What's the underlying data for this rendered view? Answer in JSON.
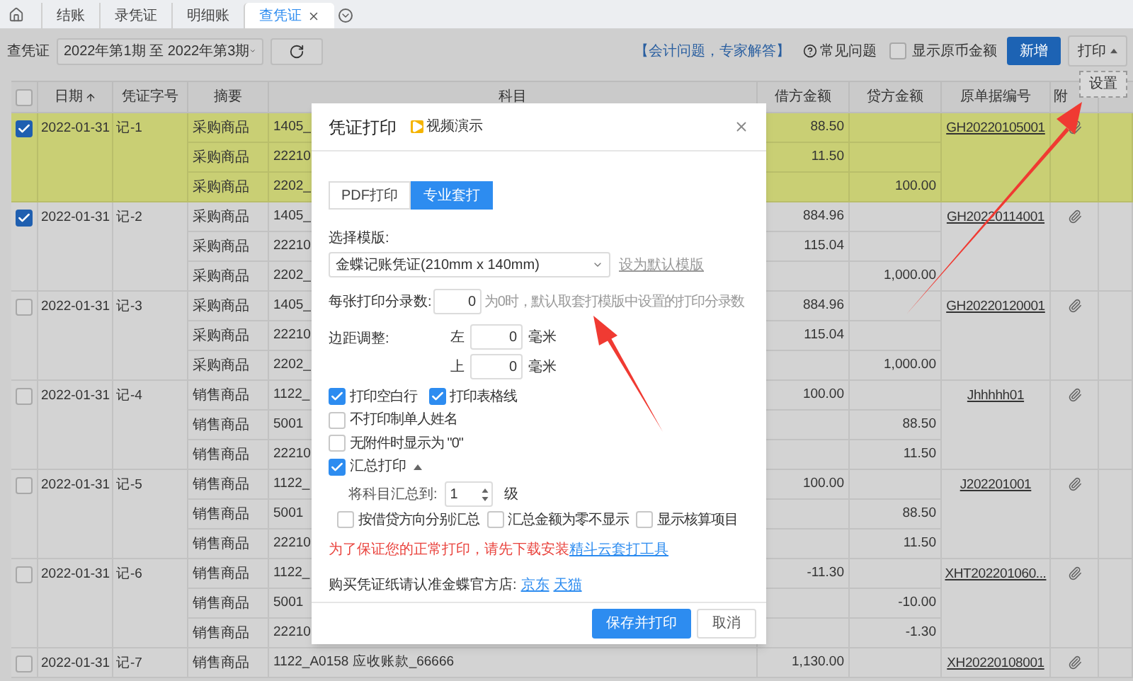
{
  "tabs": [
    {
      "label": "结账",
      "selected": false
    },
    {
      "label": "录凭证",
      "selected": false
    },
    {
      "label": "明细账",
      "selected": false
    },
    {
      "label": "查凭证",
      "selected": true
    }
  ],
  "toolbar": {
    "label": "查凭证",
    "period": "2022年第1期 至 2022年第3期",
    "help_link": "【会计问题，专家解答】",
    "faq": "常见问题",
    "show_original_currency": {
      "label": "显示原币金额",
      "checked": false
    },
    "new_button": "新增",
    "print_button": "打印",
    "print_menu": [
      "设置"
    ]
  },
  "table": {
    "select_all": {
      "checked": false
    },
    "columns": [
      {
        "label": "日期",
        "sorted": true
      },
      {
        "label": "凭证字号",
        "sorted": false
      },
      {
        "label": "摘要",
        "sorted": false
      },
      {
        "label": "科目",
        "sorted": false
      },
      {
        "label": "借方金额",
        "sorted": false
      },
      {
        "label": "贷方金额",
        "sorted": false
      },
      {
        "label": "原单据编号",
        "sorted": false
      },
      {
        "label": "附",
        "sorted": false
      }
    ],
    "vouchers": [
      {
        "checked": true,
        "highlighted": true,
        "date": "2022-01-31",
        "number": "记-1",
        "doc_no": "GH20220105001",
        "attachment": true,
        "lines": [
          {
            "summary": "采购商品",
            "account": "1405_",
            "debit": "88.50"
          },
          {
            "summary": "采购商品",
            "account": "22210",
            "debit": "11.50"
          },
          {
            "summary": "采购商品",
            "account": "2202_",
            "credit": "100.00"
          }
        ]
      },
      {
        "checked": true,
        "highlighted": false,
        "date": "2022-01-31",
        "number": "记-2",
        "doc_no": "GH20220114001",
        "attachment": true,
        "lines": [
          {
            "summary": "采购商品",
            "account": "1405_",
            "debit": "884.96"
          },
          {
            "summary": "采购商品",
            "account": "22210",
            "debit": "115.04"
          },
          {
            "summary": "采购商品",
            "account": "2202_",
            "credit": "1,000.00"
          }
        ]
      },
      {
        "checked": false,
        "highlighted": false,
        "date": "2022-01-31",
        "number": "记-3",
        "doc_no": "GH20220120001",
        "attachment": true,
        "lines": [
          {
            "summary": "采购商品",
            "account": "1405_",
            "debit": "884.96"
          },
          {
            "summary": "采购商品",
            "account": "22210",
            "debit": "115.04"
          },
          {
            "summary": "采购商品",
            "account": "2202_",
            "credit": "1,000.00"
          }
        ]
      },
      {
        "checked": false,
        "highlighted": false,
        "date": "2022-01-31",
        "number": "记-4",
        "doc_no": "Jhhhhh01",
        "attachment": true,
        "lines": [
          {
            "summary": "销售商品",
            "account": "1122_",
            "debit": "100.00"
          },
          {
            "summary": "销售商品",
            "account": "5001",
            "credit": "88.50"
          },
          {
            "summary": "销售商品",
            "account": "22210",
            "credit": "11.50"
          }
        ]
      },
      {
        "checked": false,
        "highlighted": false,
        "date": "2022-01-31",
        "number": "记-5",
        "doc_no": "J202201001",
        "attachment": true,
        "lines": [
          {
            "summary": "销售商品",
            "account": "1122_",
            "debit": "100.00"
          },
          {
            "summary": "销售商品",
            "account": "5001",
            "credit": "88.50"
          },
          {
            "summary": "销售商品",
            "account": "22210",
            "credit": "11.50"
          }
        ]
      },
      {
        "checked": false,
        "highlighted": false,
        "date": "2022-01-31",
        "number": "记-6",
        "doc_no": "XHT202201060...",
        "attachment": true,
        "lines": [
          {
            "summary": "销售商品",
            "account": "1122_",
            "debit": "-11.30"
          },
          {
            "summary": "销售商品",
            "account": "5001",
            "credit": "-10.00"
          },
          {
            "summary": "销售商品",
            "account": "22210",
            "credit": "-1.30"
          }
        ]
      },
      {
        "checked": false,
        "highlighted": false,
        "date": "2022-01-31",
        "number": "记-7",
        "doc_no": "XH20220108001",
        "attachment": true,
        "lines": [
          {
            "summary": "销售商品",
            "account": "1122_A0158 应收账款_66666",
            "debit": "1,130.00"
          }
        ]
      }
    ]
  },
  "dialog": {
    "title": "凭证打印",
    "video_link": "视频演示",
    "modes": [
      {
        "label": "PDF打印",
        "selected": false
      },
      {
        "label": "专业套打",
        "selected": true
      }
    ],
    "template": {
      "label": "选择模版:",
      "value": "金蝶记账凭证(210mm x 140mm)",
      "default_link": "设为默认模版"
    },
    "entries_per_page": {
      "label": "每张打印分录数:",
      "value": "0",
      "hint": "为0时，默认取套打模版中设置的打印分录数"
    },
    "margin": {
      "label": "边距调整:",
      "fields": [
        {
          "label": "左",
          "value": "0",
          "unit": "毫米"
        },
        {
          "label": "上",
          "value": "0",
          "unit": "毫米"
        }
      ]
    },
    "option_rows": [
      [
        {
          "label": "打印空白行",
          "checked": true
        },
        {
          "label": "打印表格线",
          "checked": true
        }
      ],
      [
        {
          "label": "不打印制单人姓名",
          "checked": false
        }
      ],
      [
        {
          "label": "无附件时显示为 \"0\"",
          "checked": false
        }
      ]
    ],
    "summary": {
      "label": "汇总打印",
      "checked": true,
      "expanded": true,
      "level_label": "将科目汇总到:",
      "level_value": "1",
      "level_unit": "级",
      "options": [
        {
          "label": "按借贷方向分别汇总",
          "checked": false
        },
        {
          "label": "汇总金额为零不显示",
          "checked": false
        },
        {
          "label": "显示核算项目",
          "checked": false
        }
      ]
    },
    "notice": {
      "text": "为了保证您的正常打印，请先下载安装",
      "link": "精斗云套打工具"
    },
    "shop": {
      "text": "购买凭证纸请认准金蝶官方店:",
      "links": [
        "京东",
        "天猫"
      ]
    },
    "buttons": [
      {
        "label": "保存并打印",
        "kind": "primary"
      },
      {
        "label": "取消",
        "kind": "secondary"
      }
    ]
  }
}
